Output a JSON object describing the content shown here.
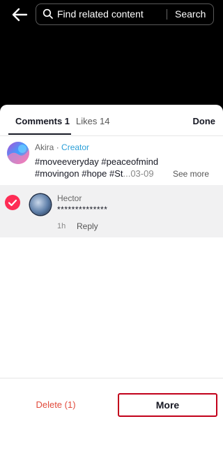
{
  "header": {
    "search_placeholder": "Find related content",
    "search_button": "Search"
  },
  "tabs": {
    "comments_label": "Comments 1",
    "likes_label": "Likes 14",
    "done_label": "Done"
  },
  "post": {
    "author_name": "Akira",
    "separator": "·",
    "author_badge": "Creator",
    "caption_line1": "#moveeveryday #peaceofmind",
    "caption_line2": "#movingon #hope #St",
    "caption_date": "...03-09",
    "see_more": "See more"
  },
  "comment": {
    "name": "Hector",
    "text": "**************",
    "time": "1h",
    "reply": "Reply"
  },
  "footer": {
    "delete_label": "Delete (1)",
    "more_label": "More"
  },
  "colors": {
    "accent_red": "#fe2c55",
    "creator_blue": "#2a9fd8",
    "highlight_border": "#c2001a"
  }
}
